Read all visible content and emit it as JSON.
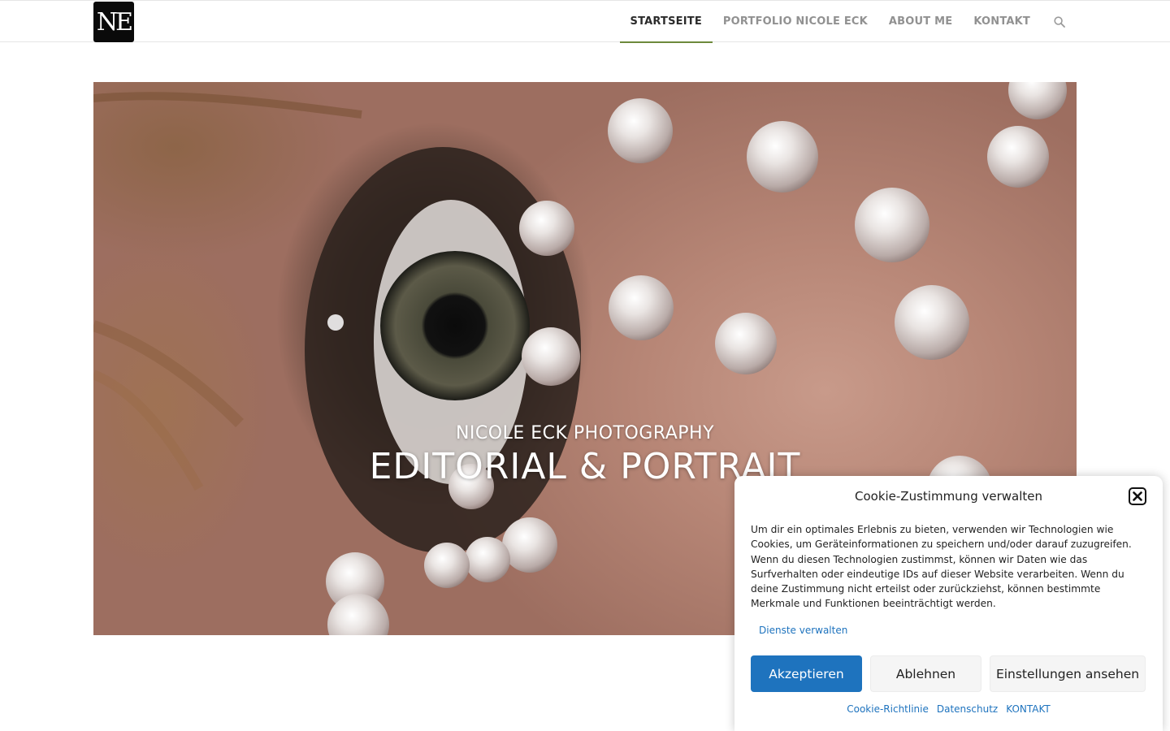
{
  "header": {
    "logo_text": "NE",
    "nav": [
      {
        "label": "STARTSEITE",
        "active": true
      },
      {
        "label": "PORTFOLIO NICOLE ECK",
        "active": false
      },
      {
        "label": "ABOUT ME",
        "active": false
      },
      {
        "label": "KONTAKT",
        "active": false
      }
    ],
    "search_icon": "search-icon",
    "accent_color": "#6d8a3b"
  },
  "hero": {
    "subtitle": "NICOLE ECK PHOTOGRAPHY",
    "title": "EDITORIAL & PORTRAIT"
  },
  "cookie": {
    "title": "Cookie-Zustimmung verwalten",
    "close_icon": "close-icon",
    "text": "Um dir ein optimales Erlebnis zu bieten, verwenden wir Technologien wie Cookies, um Geräteinformationen zu speichern und/oder darauf zuzugreifen. Wenn du diesen Technologien zustimmst, können wir Daten wie das Surfverhalten oder eindeutige IDs auf dieser Website verarbeiten. Wenn du deine Zustimmung nicht erteilst oder zurückziehst, können bestimmte Merkmale und Funktionen beeinträchtigt werden.",
    "manage_label": "Dienste verwalten",
    "accept_label": "Akzeptieren",
    "deny_label": "Ablehnen",
    "prefs_label": "Einstellungen ansehen",
    "links": [
      "Cookie-Richtlinie",
      "Datenschutz",
      "KONTAKT"
    ],
    "accent_color": "#1e73be"
  }
}
